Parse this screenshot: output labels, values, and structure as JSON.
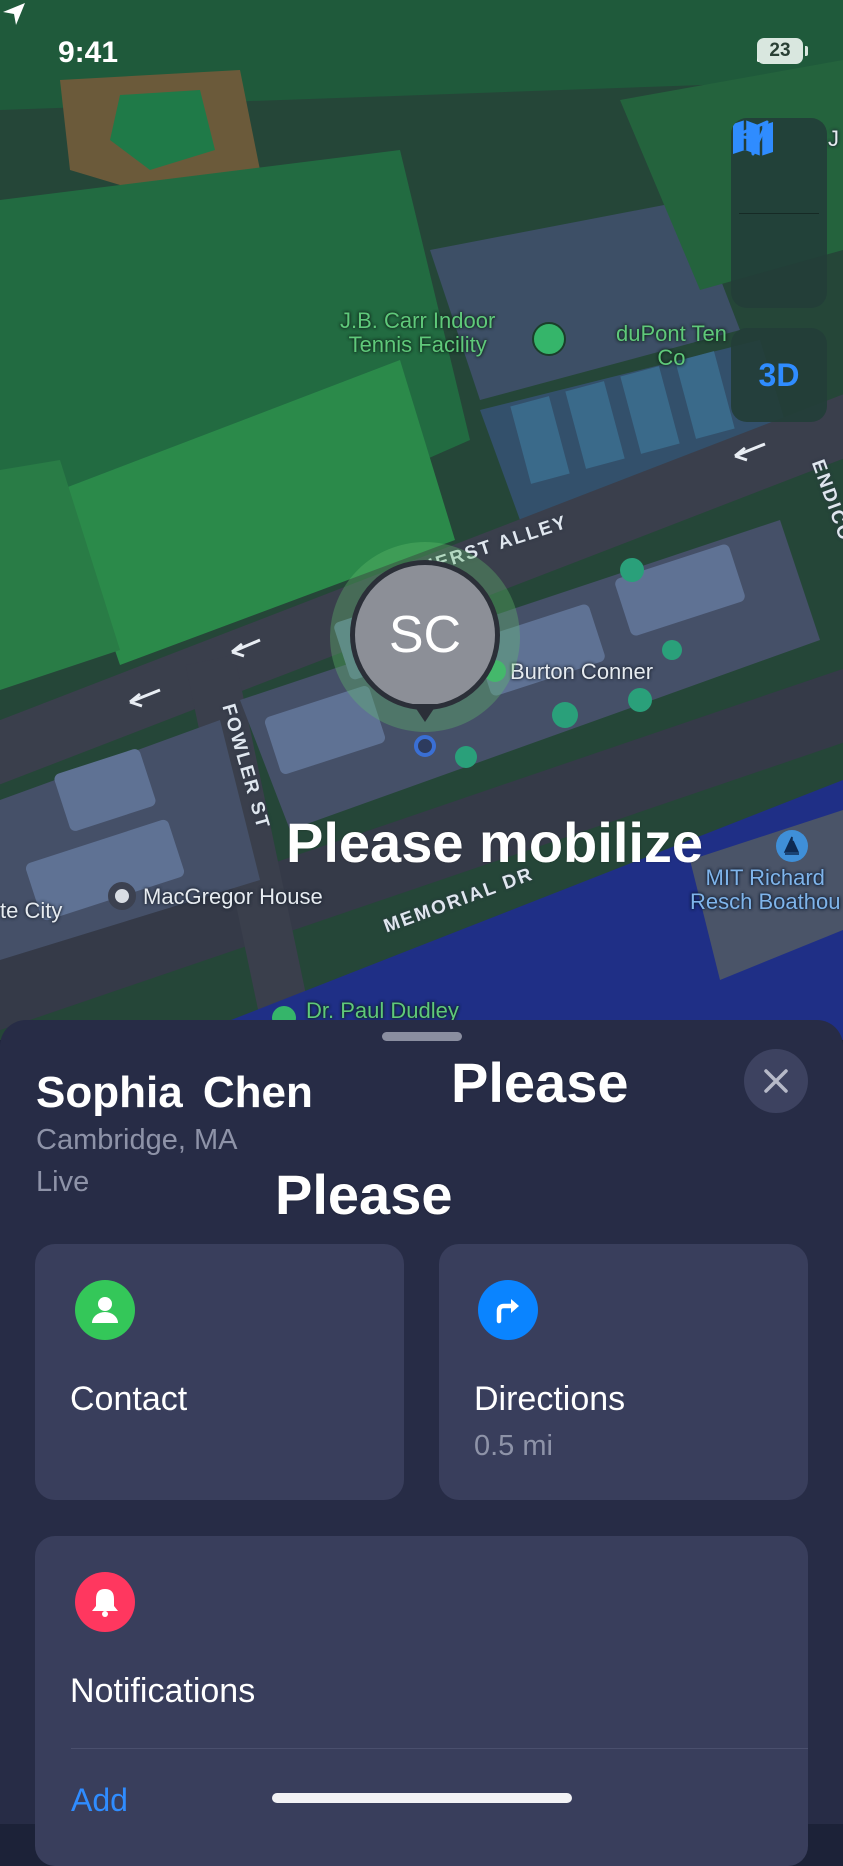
{
  "status_bar": {
    "time": "9:41",
    "battery": "23"
  },
  "map": {
    "labels": {
      "tennis": "J.B. Carr Indoor\nTennis Facility",
      "dupont": "duPont Ten\nCo",
      "j_partial": "J",
      "amherst": "HERST ALLEY",
      "endicott": "ENDICO",
      "fowler": "FOWLER ST",
      "burton": "Burton Conner",
      "macgregor": "MacGregor House",
      "city": "te City",
      "memorial": "MEMORIAL DR",
      "boathouse": "MIT Richard\nResch Boathou",
      "dudley": "Dr. Paul Dudley"
    },
    "controls": {
      "three_d": "3D"
    }
  },
  "pin": {
    "initials": "SC"
  },
  "overlays": {
    "mobilize": "Please mobilize",
    "please_top": "Please",
    "please_mid": "Please"
  },
  "sheet": {
    "name": "Sophia  Chen",
    "location": "Cambridge, MA",
    "status": "Live",
    "contact": {
      "label": "Contact",
      "icon": "person-icon",
      "color": "#34c759"
    },
    "directions": {
      "label": "Directions",
      "distance": "0.5 mi",
      "icon": "turn-right-icon",
      "color": "#0a84ff"
    },
    "notifications": {
      "label": "Notifications",
      "add": "Add",
      "icon": "bell-icon",
      "color": "#ff375f"
    }
  },
  "colors": {
    "accent": "#2f8cff",
    "sheet_bg": "#272c46",
    "card_bg": "#393e5c"
  }
}
